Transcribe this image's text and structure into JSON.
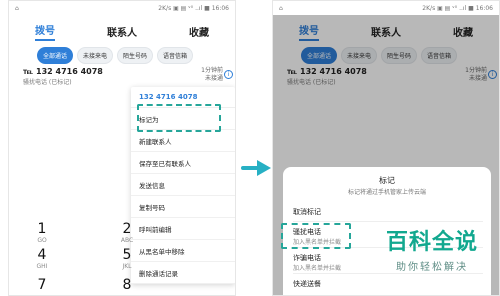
{
  "status_bar": {
    "text": "2K/s ▣ ▤ ᵛ⁰ ..ıl ■ 16:06"
  },
  "tabs": [
    "拨号",
    "联系人",
    "收藏"
  ],
  "filters": [
    "全部通话",
    "未接来电",
    "陌生号码",
    "语音信箱"
  ],
  "call": {
    "number": "℡ 132 4716 4078",
    "sub": "骚扰电话 (已标记)",
    "time": "1分钟前",
    "status": "未接通"
  },
  "menu": {
    "header": "132 4716 4078",
    "items": [
      "标记为",
      "新建联系人",
      "保存至已有联系人",
      "发送信息",
      "复制号码",
      "呼叫前编辑",
      "从黑名单中移除",
      "删除通话记录"
    ]
  },
  "keypad": {
    "row1": [
      {
        "n": "1",
        "sub": "GO"
      },
      {
        "n": "2",
        "sub": "ABC"
      }
    ],
    "row2": [
      {
        "n": "4",
        "sub": "GHI"
      },
      {
        "n": "5",
        "sub": "JKL"
      }
    ],
    "row3": [
      {
        "n": "7",
        "sub": ""
      },
      {
        "n": "8",
        "sub": ""
      }
    ]
  },
  "sheet": {
    "title": "标记",
    "subtitle": "标记将通过手机管家上传云端",
    "options": [
      {
        "label": "取消标记",
        "sub": ""
      },
      {
        "label": "骚扰电话",
        "sub": "加入黑名单并拦截"
      },
      {
        "label": "诈骗电话",
        "sub": "加入黑名单并拦截"
      },
      {
        "label": "快递送餐",
        "sub": ""
      }
    ]
  },
  "brand": {
    "main": "百科全说",
    "sub": "助你轻松解决"
  }
}
